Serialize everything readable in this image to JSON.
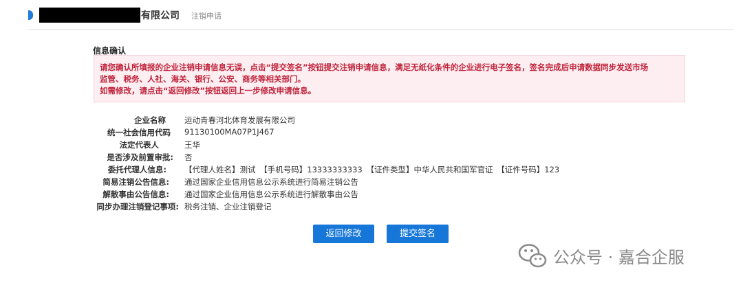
{
  "header": {
    "company_suffix": "有限公司",
    "subtitle": "注销申请"
  },
  "section": {
    "title": "信息确认"
  },
  "notice": {
    "line1": "请您确认所填报的企业注销申请信息无误，点击“提交签名”按钮提交注销申请信息，满足无纸化条件的企业进行电子签名，签名完成后申请数据同步发送市场",
    "line2": "监管、税务、人社、海关、银行、公安、商务等相关部门。",
    "line3": "如需修改，请点击“返回修改”按钮返回上一步修改申请信息。"
  },
  "fields": [
    {
      "label": "企业名称",
      "value": "运动青春河北体育发展有限公司"
    },
    {
      "label": "统一社会信用代码",
      "value": "91130100MA07P1J467"
    },
    {
      "label": "法定代表人",
      "value": "王华"
    },
    {
      "label": "是否涉及前置审批:",
      "value": "否"
    },
    {
      "label": "委托代理人信息:",
      "value": "【代理人姓名】测试　【手机号码】13333333333　【证件类型】中华人民共和国军官证　【证件号码】123"
    },
    {
      "label": "简易注销公告信息:",
      "value": "通过国家企业信用信息公示系统进行简易注销公告"
    },
    {
      "label": "解散事由公告信息:",
      "value": "通过国家企业信用信息公示系统进行解散事由公告"
    },
    {
      "label": "同步办理注销登记事项:",
      "value": "税务注销、企业注销登记"
    }
  ],
  "buttons": {
    "back": "返回修改",
    "submit": "提交签名"
  },
  "watermark": {
    "text": "公众号 · 嘉合企服"
  }
}
